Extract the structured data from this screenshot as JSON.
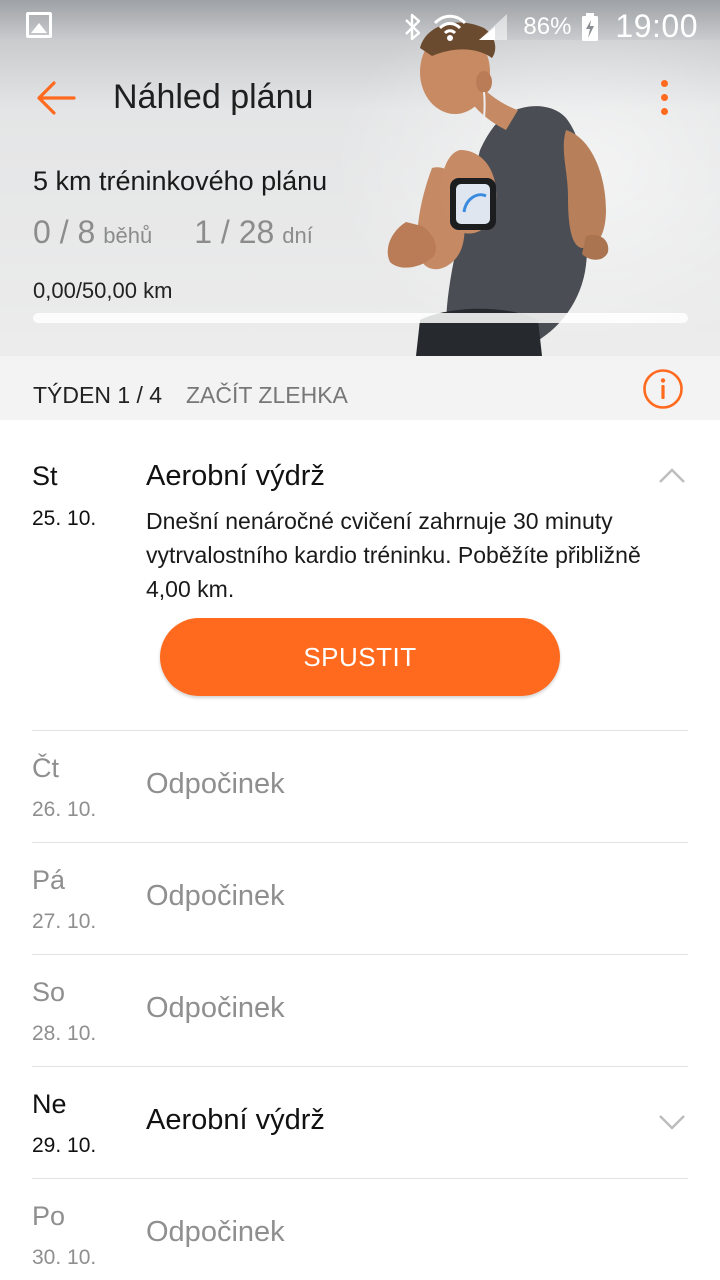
{
  "status_bar": {
    "battery_percent": "86%",
    "time": "19:00",
    "icons": [
      "picture-icon",
      "bluetooth-icon",
      "wifi-icon",
      "signal-icon",
      "battery-charging-icon"
    ]
  },
  "app_bar": {
    "title": "Náhled plánu",
    "back_icon": "arrow-left-icon",
    "more_icon": "more-vertical-icon"
  },
  "plan": {
    "title": "5 km tréninkového plánu",
    "runs_value": "0 / 8",
    "runs_unit": "běhů",
    "days_value": "1 / 28",
    "days_unit": "dní",
    "distance": "0,00/50,00 km",
    "progress_fraction": 0.0
  },
  "week": {
    "number": "TÝDEN 1 / 4",
    "name": "ZAČÍT ZLEHKA",
    "info_icon": "info-icon"
  },
  "days": [
    {
      "day": "St",
      "date": "25. 10.",
      "title": "Aerobní výdrž",
      "expanded": true,
      "description": "Dnešní nenáročné cvičení zahrnuje 30 minuty vytrvalostního kardio tréninku. Poběžíte přibližně 4,00 km.",
      "button": "SPUSTIT"
    },
    {
      "day": "Čt",
      "date": "26. 10.",
      "title": "Odpočinek"
    },
    {
      "day": "Pá",
      "date": "27. 10.",
      "title": "Odpočinek"
    },
    {
      "day": "So",
      "date": "28. 10.",
      "title": "Odpočinek"
    },
    {
      "day": "Ne",
      "date": "29. 10.",
      "title": "Aerobní výdrž",
      "expanded": false
    },
    {
      "day": "Po",
      "date": "30. 10.",
      "title": "Odpočinek"
    }
  ],
  "colors": {
    "accent": "#ff6a1f",
    "text_primary": "#111111",
    "text_muted": "#8f8f8f",
    "week_bar_bg": "#f3f3f3"
  }
}
